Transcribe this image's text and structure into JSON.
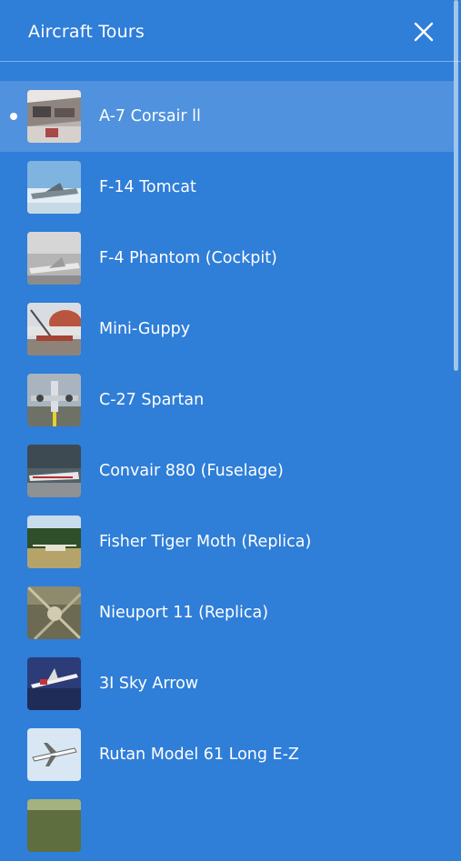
{
  "header": {
    "title": "Aircraft Tours",
    "close_icon": "close-icon"
  },
  "colors": {
    "background": "#2F7ED8",
    "active_row": "#4F92DE",
    "text": "#FFFFFF"
  },
  "tours": [
    {
      "label": "A-7 Corsair ll",
      "active": true
    },
    {
      "label": "F-14 Tomcat",
      "active": false
    },
    {
      "label": "F-4 Phantom (Cockpit)",
      "active": false
    },
    {
      "label": "Mini-Guppy",
      "active": false
    },
    {
      "label": "C-27 Spartan",
      "active": false
    },
    {
      "label": "Convair 880 (Fuselage)",
      "active": false
    },
    {
      "label": "Fisher Tiger Moth (Replica)",
      "active": false
    },
    {
      "label": "Nieuport 11 (Replica)",
      "active": false
    },
    {
      "label": "3I Sky Arrow",
      "active": false
    },
    {
      "label": "Rutan Model 61 Long E-Z",
      "active": false
    },
    {
      "label": "",
      "active": false
    }
  ]
}
